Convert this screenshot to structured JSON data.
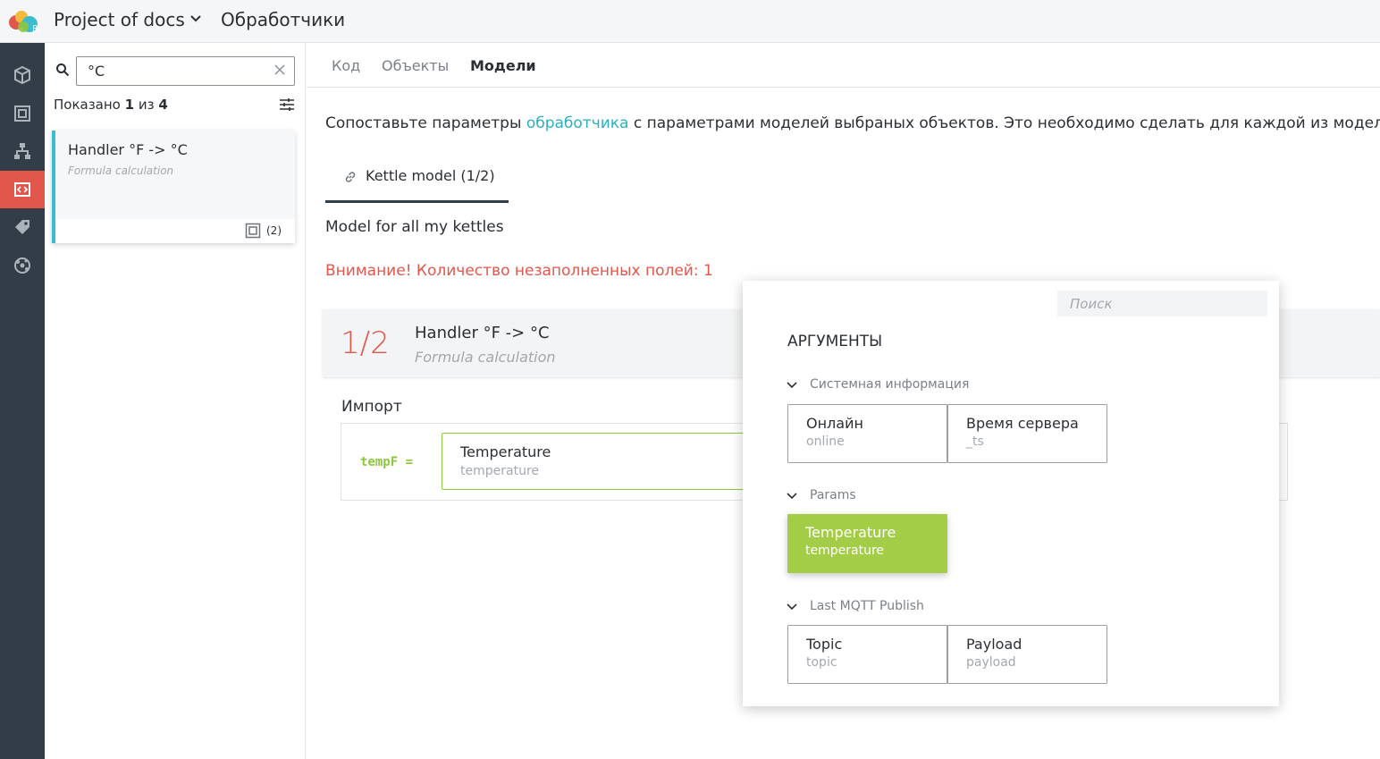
{
  "topbar": {
    "project": "Project of docs",
    "section": "Обработчики"
  },
  "rail": {
    "items": [
      "cube-icon",
      "object-icon",
      "hierarchy-icon",
      "handlers-icon",
      "tag-icon",
      "network-icon"
    ],
    "active_index": 3
  },
  "sidebar": {
    "search": {
      "value": "°C"
    },
    "shown": {
      "prefix": "Показано",
      "current": "1",
      "mid": "из",
      "total": "4"
    },
    "cards": [
      {
        "title": "Handler °F -> °C",
        "subtitle": "Formula calculation",
        "count": "(2)"
      }
    ]
  },
  "tabs": [
    {
      "label": "Код"
    },
    {
      "label": "Объекты"
    },
    {
      "label": "Модели"
    }
  ],
  "active_tab": "Модели",
  "main": {
    "intro_before": "Сопоставьте параметры ",
    "intro_link": "обработчика",
    "intro_after": " с параметрами моделей выбраных объектов. Это необходимо сделать для каждой из моделей.",
    "model_tab": "Kettle model (1/2)",
    "model_description": "Model for all my kettles",
    "warning": "Внимание! Количество незаполненных полей: 1",
    "handler": {
      "fraction": "1/2",
      "title": "Handler °F -> °C",
      "subtitle": "Formula calculation"
    },
    "import": {
      "label": "Импорт",
      "variable": "tempF =",
      "slot": {
        "title": "Temperature",
        "subtitle": "temperature"
      }
    }
  },
  "popup": {
    "search_placeholder": "Поиск",
    "title": "АРГУМЕНТЫ",
    "groups": [
      {
        "name": "Системная информация",
        "items": [
          {
            "title": "Онлайн",
            "sub": "online"
          },
          {
            "title": "Время сервера",
            "sub": "_ts"
          }
        ]
      },
      {
        "name": "Params",
        "items": [
          {
            "title": "Temperature",
            "sub": "temperature",
            "selected": true
          }
        ]
      },
      {
        "name": "Last MQTT Publish",
        "items": [
          {
            "title": "Topic",
            "sub": "topic"
          },
          {
            "title": "Payload",
            "sub": "payload"
          }
        ]
      }
    ]
  },
  "colors": {
    "accent_red": "#e2574c",
    "accent_green": "#a3cc47",
    "link": "#2ab0c5",
    "rail": "#333d48"
  }
}
